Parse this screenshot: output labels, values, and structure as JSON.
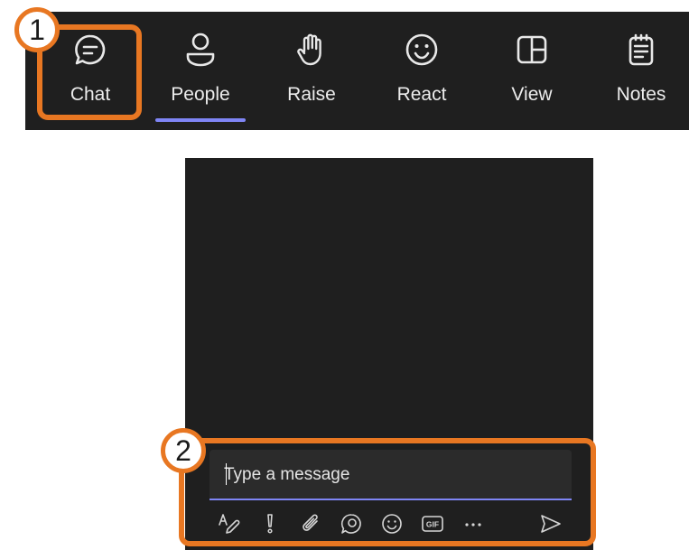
{
  "toolbar": {
    "items": [
      {
        "label": "Chat",
        "icon": "chat-bubble-icon"
      },
      {
        "label": "People",
        "icon": "people-icon"
      },
      {
        "label": "Raise",
        "icon": "raise-hand-icon"
      },
      {
        "label": "React",
        "icon": "smiley-icon"
      },
      {
        "label": "View",
        "icon": "grid-layout-icon"
      },
      {
        "label": "Notes",
        "icon": "notes-icon"
      }
    ],
    "active_item": "People"
  },
  "compose": {
    "placeholder": "Type a message",
    "tools": [
      "format-icon",
      "important-icon",
      "attach-icon",
      "loop-icon",
      "emoji-icon",
      "gif-icon",
      "more-icon",
      "send-icon"
    ],
    "gif_label": "GIF"
  },
  "callouts": {
    "one": "1",
    "two": "2"
  },
  "colors": {
    "accent": "#7f85f5",
    "callout": "#e87722",
    "background": "#1f1f1f"
  }
}
